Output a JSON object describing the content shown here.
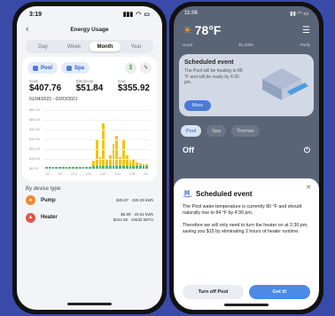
{
  "left": {
    "status_time": "3:19",
    "nav_title": "Energy Usage",
    "tabs": [
      "Day",
      "Week",
      "Month",
      "Year"
    ],
    "active_tab": "Month",
    "pills": [
      "Pool",
      "Spa"
    ],
    "costs": [
      {
        "label": "Cost:",
        "value": "$407.76"
      },
      {
        "label": "Electricity:",
        "value": "$51.84"
      },
      {
        "label": "Gas:",
        "value": "$355.92"
      }
    ],
    "date_range": "01/04/2021 - 02/03/2021",
    "chart_data": {
      "type": "bar",
      "yticks": [
        "$60.00",
        "$50.00",
        "$40.00",
        "$30.00",
        "$20.00",
        "$10.00",
        "$0.00"
      ],
      "ylim": [
        0,
        60
      ],
      "x_ticks": [
        "1/4",
        "1/8",
        "1/12",
        "1/16",
        "1/20",
        "1/24",
        "1/28",
        "2/1"
      ],
      "series": [
        {
          "name": "Gas",
          "values": [
            0,
            0,
            0,
            0,
            0,
            0,
            0,
            0,
            0,
            0,
            0,
            0,
            0,
            0,
            6,
            30,
            10,
            48,
            8,
            12,
            25,
            34,
            10,
            30,
            12,
            6,
            8,
            4,
            3,
            2,
            2
          ]
        },
        {
          "name": "Electricity",
          "values": [
            2,
            2,
            2,
            2,
            2,
            2,
            2,
            2,
            2,
            2,
            2,
            2,
            2,
            2,
            3,
            3,
            3,
            3,
            3,
            3,
            3,
            3,
            3,
            3,
            3,
            3,
            3,
            3,
            3,
            3,
            3
          ]
        }
      ]
    },
    "section_title": "By device type:",
    "devices": [
      {
        "name": "Pump",
        "line1": "$45.97 · 328.26 kWh",
        "line2": ""
      },
      {
        "name": "Heater",
        "line1": "$5.89 · 20.61 kWh",
        "line2": "$341.69 · 10632 kBTU"
      }
    ],
    "colors": {
      "gas": "#f4c20f",
      "electric": "#4fb36c",
      "accent": "#2c5fc7"
    }
  },
  "right": {
    "status_time": "11:06",
    "temperature": "78°F",
    "stats": [
      "Good",
      "$1.20/hr",
      "Partly"
    ],
    "card_title": "Scheduled event",
    "card_text": "The Pool will be heating to 88 °F and will be ready by 4:30 pm.",
    "more_label": "More",
    "tabs": [
      "Pool",
      "Spa",
      "Themes"
    ],
    "off_label": "Off",
    "sheet": {
      "title": "Scheduled event",
      "para1": "The Pool water temperature is currently 80 °F and should naturally rise to 84 °F by 4:30 pm.",
      "para2": "Therefore we will only need to turn the heater on at 2:30 pm, saving you $15 by eliminating 2 hours of heater runtime.",
      "btn_secondary": "Turn off Pool",
      "btn_primary": "Got it!"
    }
  }
}
